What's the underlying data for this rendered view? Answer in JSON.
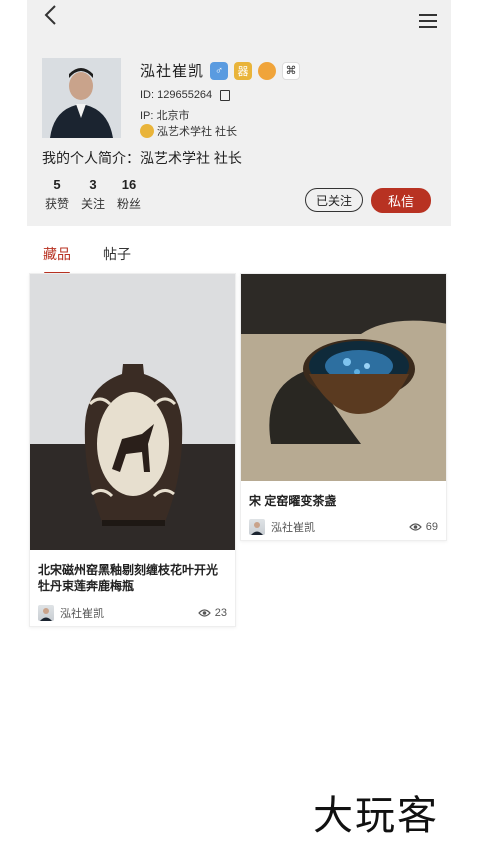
{
  "profile": {
    "name": "泓社崔凯",
    "badges": {
      "gender": "♂",
      "level": "器",
      "honor": "",
      "mark": "⌘"
    },
    "id_text": "ID: 129655264",
    "ip_text": "IP: 北京市",
    "org_text": "泓艺术学社 社长",
    "intro": "我的个人简介：泓艺术学社 社长",
    "stats": [
      {
        "value": "5",
        "label": "获赞"
      },
      {
        "value": "3",
        "label": "关注"
      },
      {
        "value": "16",
        "label": "粉丝"
      }
    ],
    "follow_label": "已关注",
    "message_label": "私信"
  },
  "tabs": [
    {
      "label": "藏品",
      "active": true
    },
    {
      "label": "帖子",
      "active": false
    }
  ],
  "cards": [
    {
      "title": "北宋磁州窑黑釉剔刻缠枝花叶开光牡丹束莲奔鹿梅瓶",
      "author": "泓社崔凯",
      "views": "23"
    },
    {
      "title": "宋 定窑曜变茶盏",
      "author": "泓社崔凯",
      "views": "69"
    }
  ],
  "colors": {
    "accent": "#b83222",
    "header_bg": "#f0f0f0"
  },
  "icons": [
    "back-icon",
    "menu-icon",
    "copy-icon",
    "eye-icon"
  ],
  "watermark": "大玩客"
}
